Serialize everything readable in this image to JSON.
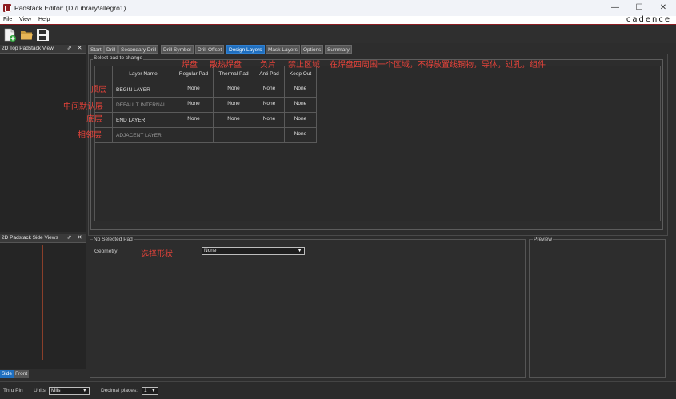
{
  "window": {
    "title": "Padstack Editor:  (D:/Library/allegro1)",
    "minimize": "—",
    "maximize": "☐",
    "close": "✕"
  },
  "menu": {
    "file": "File",
    "view": "View",
    "help": "Help",
    "brand": "cadence"
  },
  "toolbar": {
    "new_icon": "new-file-icon",
    "open_icon": "open-folder-icon",
    "save_icon": "save-disk-icon"
  },
  "left": {
    "top_view_title": "2D Top Padstack View",
    "side_view_title": "2D Padstack Side Views",
    "float_glyph": "⇗",
    "close_glyph": "✕",
    "side_tabs": [
      "Side",
      "Front"
    ]
  },
  "tabs": [
    "Start",
    "Drill",
    "Secondary Drill",
    "Drill Symbol",
    "Drill Offset",
    "Design Layers",
    "Mask Layers",
    "Options",
    "Summary"
  ],
  "active_tab": "Design Layers",
  "design_layers": {
    "group_label": "Select pad to change",
    "columns": [
      "Layer Name",
      "Regular Pad",
      "Thermal Pad",
      "Anti Pad",
      "Keep Out"
    ],
    "rows": [
      {
        "name": "BEGIN LAYER",
        "values": [
          "None",
          "None",
          "None",
          "None"
        ]
      },
      {
        "name": "DEFAULT INTERNAL",
        "values": [
          "None",
          "None",
          "None",
          "None"
        ]
      },
      {
        "name": "END LAYER",
        "values": [
          "None",
          "None",
          "None",
          "None"
        ]
      },
      {
        "name": "ADJACENT LAYER",
        "values": [
          "-",
          "-",
          "-",
          "None"
        ]
      }
    ]
  },
  "annotations": {
    "regular_pad": "焊盘",
    "thermal_pad": "散热焊盘",
    "anti_pad": "负片",
    "keep_out": "禁止区域",
    "keep_out_desc": "在焊盘四周围一个区域，不得放置线铜物，导体，过孔，组件",
    "top": "顶层",
    "internal": "中间默认层",
    "bottom": "底层",
    "adjacent": "相邻层",
    "shape": "选择形状"
  },
  "pad_props": {
    "title": "No Selected Pad",
    "geometry_label": "Geometry:",
    "geometry_value": "None",
    "preview_label": "Preview"
  },
  "status": {
    "mode": "Thru Pin",
    "units_label": "Units:",
    "units_value": "Mils",
    "decimal_label": "Decimal places:",
    "decimal_value": "1"
  }
}
